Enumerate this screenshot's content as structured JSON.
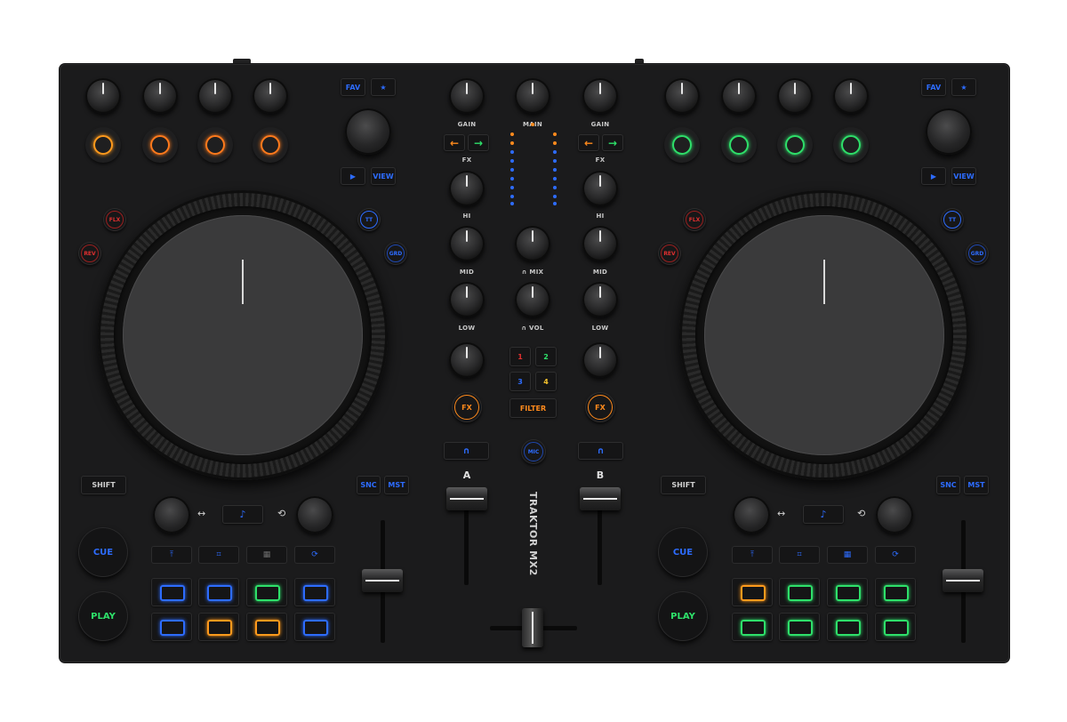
{
  "device": {
    "logo": "TRAKTOR MX2"
  },
  "colors": {
    "blue": "#2d6cff",
    "orange": "#ff8a1c",
    "green": "#2ee06a",
    "red": "#e03030",
    "yellow": "#f2c12e",
    "teal": "#2ce0a0"
  },
  "deck_a": {
    "fav": "FAV",
    "star": "★",
    "play_icon": "▶",
    "view": "VIEW",
    "flx": "FLX",
    "rev": "REV",
    "tt": "TT",
    "grd": "GRD",
    "shift": "SHIFT",
    "snc": "SNC",
    "mst": "MST",
    "cue": "CUE",
    "play": "PLAY",
    "tempo_left_icon": "↔",
    "tempo_right_icon": "⟲",
    "note_icon": "♪",
    "mode_icons": [
      "⤒",
      "⌗",
      "▦",
      "⟳"
    ],
    "ring_colors": [
      "#ff9a1c",
      "#ff7a1c",
      "#ff7a1c",
      "#ff7a1c"
    ],
    "pad_colors": [
      "#2d6cff",
      "#2d6cff",
      "#2ee06a",
      "#2d6cff",
      "#2d6cff",
      "#ff9a1c",
      "#ff9a1c",
      "#2d6cff"
    ]
  },
  "deck_b": {
    "fav": "FAV",
    "star": "★",
    "play_icon": "▶",
    "view": "VIEW",
    "flx": "FLX",
    "rev": "REV",
    "tt": "TT",
    "grd": "GRD",
    "shift": "SHIFT",
    "snc": "SNC",
    "mst": "MST",
    "cue": "CUE",
    "play": "PLAY",
    "tempo_left_icon": "↔",
    "tempo_right_icon": "⟲",
    "note_icon": "♪",
    "mode_icons": [
      "⤒",
      "⌗",
      "▦",
      "⟳"
    ],
    "ring_colors": [
      "#2ee06a",
      "#2ee06a",
      "#2ee06a",
      "#2ee06a"
    ],
    "pad_colors": [
      "#ff9a1c",
      "#2ee06a",
      "#2ee06a",
      "#2ee06a",
      "#2ee06a",
      "#2ee06a",
      "#2ee06a",
      "#2ee06a"
    ]
  },
  "mixer": {
    "gain": "GAIN",
    "main": "MAIN",
    "fx": "FX",
    "hi": "HI",
    "mid": "MID",
    "low": "LOW",
    "hp_mix": "∩ MIX",
    "hp_vol": "∩ VOL",
    "fx_numbers": [
      "1",
      "2",
      "3",
      "4"
    ],
    "filter": "FILTER",
    "fx_button": "FX",
    "channel_a": "A",
    "channel_b": "B",
    "arrow_left": "←",
    "arrow_right": "→",
    "cue_icon": "∩",
    "mic": "MIC"
  }
}
